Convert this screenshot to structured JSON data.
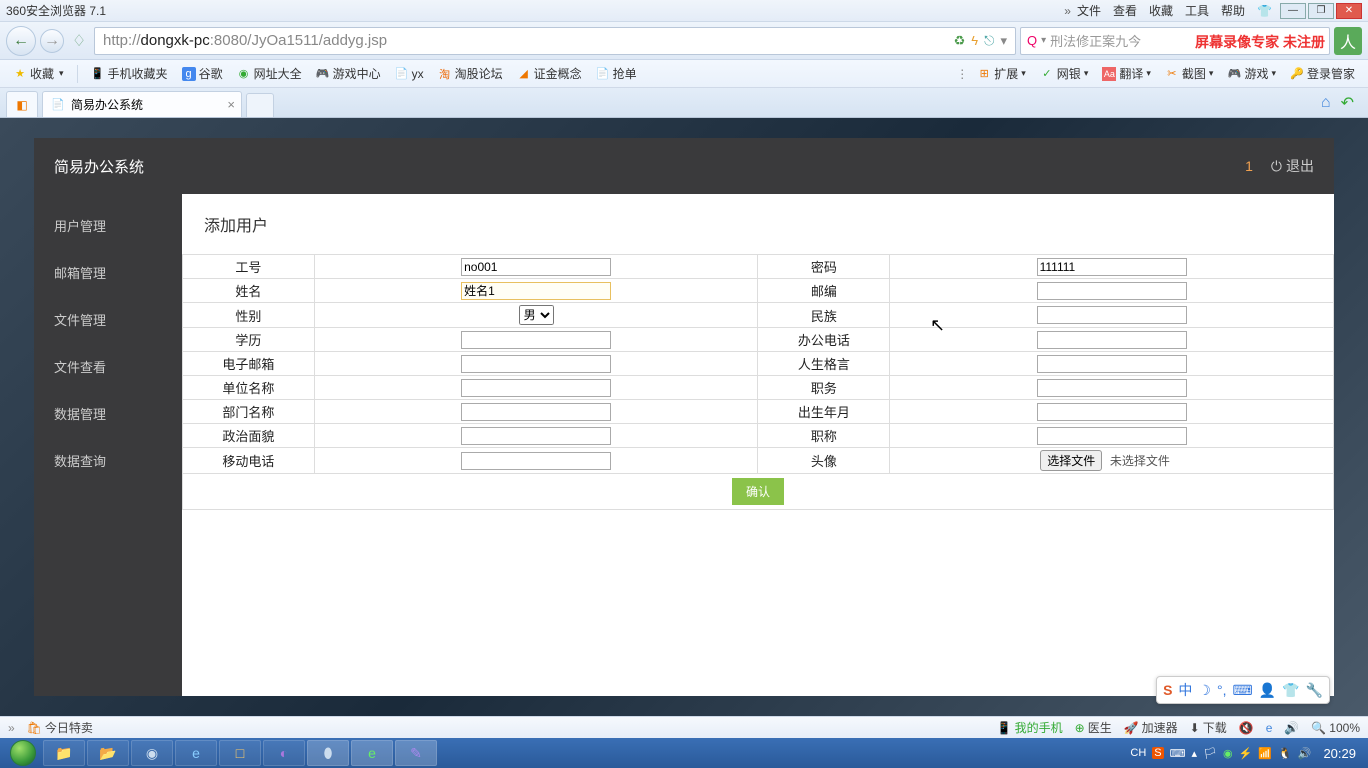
{
  "browser": {
    "title": "360安全浏览器 7.1",
    "menus": [
      "文件",
      "查看",
      "收藏",
      "工具",
      "帮助"
    ],
    "url_prefix": "http://",
    "url_host": "dongxk-pc",
    "url_rest": ":8080/JyOa1511/addyg.jsp",
    "search_placeholder": "刑法修正案九今",
    "watermark": "屏幕录像专家 未注册"
  },
  "bookmarks": {
    "fav": "收藏",
    "items": [
      "手机收藏夹",
      "谷歌",
      "网址大全",
      "游戏中心",
      "yx",
      "淘股论坛",
      "证金概念",
      "抢单"
    ],
    "right": {
      "ext": "扩展",
      "bank": "网银",
      "trans": "翻译",
      "shot": "截图",
      "game": "游戏",
      "login": "登录管家"
    }
  },
  "tab": {
    "title": "简易办公系统"
  },
  "page": {
    "app_title": "简易办公系统",
    "count": "1",
    "logout": "退出",
    "sidebar": [
      "用户管理",
      "邮箱管理",
      "文件管理",
      "文件查看",
      "数据管理",
      "数据查询"
    ],
    "heading": "添加用户",
    "form": {
      "labels": {
        "no": "工号",
        "pwd": "密码",
        "name": "姓名",
        "zip": "邮编",
        "sex": "性别",
        "nation": "民族",
        "edu": "学历",
        "tel": "办公电话",
        "email": "电子邮箱",
        "motto": "人生格言",
        "org": "单位名称",
        "duty": "职务",
        "dept": "部门名称",
        "birth": "出生年月",
        "pol": "政治面貌",
        "title": "职称",
        "mobile": "移动电话",
        "avatar": "头像"
      },
      "values": {
        "no": "no001",
        "pwd": "111111",
        "name": "姓名1",
        "sex": "男"
      },
      "file_btn": "选择文件",
      "file_none": "未选择文件",
      "submit": "确认"
    }
  },
  "status": {
    "today": "今日特卖",
    "phone": "我的手机",
    "doctor": "医生",
    "acc": "加速器",
    "dl": "下载",
    "mute": "",
    "e": "e",
    "vol": "",
    "zoom": "100%"
  },
  "tray": {
    "lang": "CH",
    "clock": "20:29"
  },
  "ime": {
    "s": "S",
    "zhong": "中"
  }
}
